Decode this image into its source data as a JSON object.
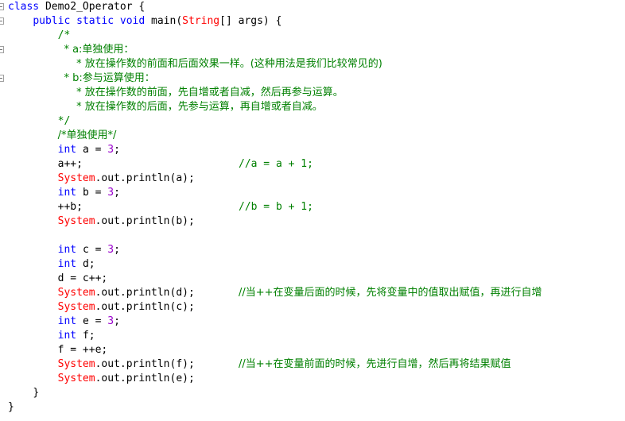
{
  "editor": {
    "language": "java",
    "class_name": "Demo2_Operator",
    "background_color": "#ffffff",
    "colors": {
      "keyword": "#0000ff",
      "class": "#ff0000",
      "number": "#9900cc",
      "comment": "#008000",
      "plain": "#000000",
      "fold_marker": "#a0a0a0"
    }
  },
  "gutter": {
    "fold_markers": [
      {
        "line": 1,
        "state": "expanded",
        "glyph": "minus"
      },
      {
        "line": 2,
        "state": "expanded",
        "glyph": "minus"
      },
      {
        "line": 4,
        "state": "expanded",
        "glyph": "minus"
      },
      {
        "line": 6,
        "state": "expanded",
        "glyph": "minus"
      }
    ]
  },
  "lines": [
    {
      "n": 1,
      "indent": 0,
      "tokens": [
        {
          "t": "class ",
          "c": "kw"
        },
        {
          "t": "Demo2_Operator {",
          "c": "plain"
        }
      ]
    },
    {
      "n": 2,
      "indent": 4,
      "tokens": [
        {
          "t": "public static void ",
          "c": "kw"
        },
        {
          "t": "main(",
          "c": "plain"
        },
        {
          "t": "String",
          "c": "cls"
        },
        {
          "t": "[] args) {",
          "c": "plain"
        }
      ]
    },
    {
      "n": 3,
      "indent": 8,
      "tokens": [
        {
          "t": "/*",
          "c": "cmt"
        }
      ]
    },
    {
      "n": 4,
      "indent": 9,
      "tokens": [
        {
          "t": "* a:单独使用：",
          "c": "cmt"
        }
      ]
    },
    {
      "n": 5,
      "indent": 11,
      "tokens": [
        {
          "t": "* 放在操作数的前面和后面效果一样。(这种用法是我们比较常见的)",
          "c": "cmt"
        }
      ]
    },
    {
      "n": 6,
      "indent": 9,
      "tokens": [
        {
          "t": "* b:参与运算使用：",
          "c": "cmt"
        }
      ]
    },
    {
      "n": 7,
      "indent": 11,
      "tokens": [
        {
          "t": "* 放在操作数的前面，先自增或者自减，然后再参与运算。",
          "c": "cmt"
        }
      ]
    },
    {
      "n": 8,
      "indent": 11,
      "tokens": [
        {
          "t": "* 放在操作数的后面，先参与运算，再自增或者自减。",
          "c": "cmt"
        }
      ]
    },
    {
      "n": 9,
      "indent": 8,
      "tokens": [
        {
          "t": "*/",
          "c": "cmt"
        }
      ]
    },
    {
      "n": 10,
      "indent": 8,
      "tokens": [
        {
          "t": "/*单独使用*/",
          "c": "cmt"
        }
      ]
    },
    {
      "n": 11,
      "indent": 8,
      "tokens": [
        {
          "t": "int ",
          "c": "kw"
        },
        {
          "t": "a = ",
          "c": "plain"
        },
        {
          "t": "3",
          "c": "num"
        },
        {
          "t": ";",
          "c": "plain"
        }
      ]
    },
    {
      "n": 12,
      "indent": 8,
      "tokens": [
        {
          "t": "a++;",
          "c": "plain"
        }
      ],
      "trailing_comment": "//a = a + 1;"
    },
    {
      "n": 13,
      "indent": 8,
      "tokens": [
        {
          "t": "System",
          "c": "cls"
        },
        {
          "t": ".out.println(a);",
          "c": "plain"
        }
      ]
    },
    {
      "n": 14,
      "indent": 8,
      "tokens": [
        {
          "t": "int ",
          "c": "kw"
        },
        {
          "t": "b = ",
          "c": "plain"
        },
        {
          "t": "3",
          "c": "num"
        },
        {
          "t": ";",
          "c": "plain"
        }
      ]
    },
    {
      "n": 15,
      "indent": 8,
      "tokens": [
        {
          "t": "++b;",
          "c": "plain"
        }
      ],
      "trailing_comment": "//b = b + 1;"
    },
    {
      "n": 16,
      "indent": 8,
      "tokens": [
        {
          "t": "System",
          "c": "cls"
        },
        {
          "t": ".out.println(b);",
          "c": "plain"
        }
      ]
    },
    {
      "n": 17,
      "indent": 0,
      "tokens": []
    },
    {
      "n": 18,
      "indent": 8,
      "tokens": [
        {
          "t": "int ",
          "c": "kw"
        },
        {
          "t": "c = ",
          "c": "plain"
        },
        {
          "t": "3",
          "c": "num"
        },
        {
          "t": ";",
          "c": "plain"
        }
      ]
    },
    {
      "n": 19,
      "indent": 8,
      "tokens": [
        {
          "t": "int ",
          "c": "kw"
        },
        {
          "t": "d;",
          "c": "plain"
        }
      ]
    },
    {
      "n": 20,
      "indent": 8,
      "tokens": [
        {
          "t": "d = c++;",
          "c": "plain"
        }
      ]
    },
    {
      "n": 21,
      "indent": 8,
      "tokens": [
        {
          "t": "System",
          "c": "cls"
        },
        {
          "t": ".out.println(d);",
          "c": "plain"
        }
      ],
      "trailing_comment": "//当++在变量后面的时候，先将变量中的值取出赋值，再进行自增"
    },
    {
      "n": 22,
      "indent": 8,
      "tokens": [
        {
          "t": "System",
          "c": "cls"
        },
        {
          "t": ".out.println(c);",
          "c": "plain"
        }
      ]
    },
    {
      "n": 23,
      "indent": 8,
      "tokens": [
        {
          "t": "int ",
          "c": "kw"
        },
        {
          "t": "e = ",
          "c": "plain"
        },
        {
          "t": "3",
          "c": "num"
        },
        {
          "t": ";",
          "c": "plain"
        }
      ]
    },
    {
      "n": 24,
      "indent": 8,
      "tokens": [
        {
          "t": "int ",
          "c": "kw"
        },
        {
          "t": "f;",
          "c": "plain"
        }
      ]
    },
    {
      "n": 25,
      "indent": 8,
      "tokens": [
        {
          "t": "f = ++e;",
          "c": "plain"
        }
      ]
    },
    {
      "n": 26,
      "indent": 8,
      "tokens": [
        {
          "t": "System",
          "c": "cls"
        },
        {
          "t": ".out.println(f);",
          "c": "plain"
        }
      ],
      "trailing_comment": "//当++在变量前面的时候，先进行自增，然后再将结果赋值"
    },
    {
      "n": 27,
      "indent": 8,
      "tokens": [
        {
          "t": "System",
          "c": "cls"
        },
        {
          "t": ".out.println(e);",
          "c": "plain"
        }
      ]
    },
    {
      "n": 28,
      "indent": 4,
      "tokens": [
        {
          "t": "}",
          "c": "plain"
        }
      ]
    },
    {
      "n": 29,
      "indent": 0,
      "tokens": [
        {
          "t": "}",
          "c": "plain"
        }
      ]
    }
  ]
}
